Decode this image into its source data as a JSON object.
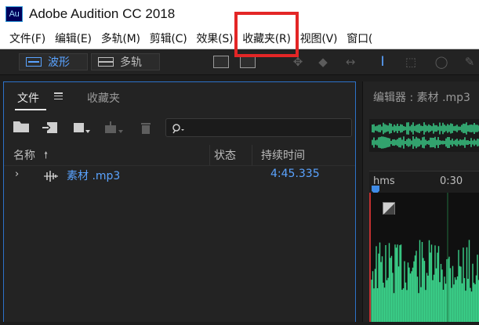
{
  "window": {
    "app_icon_text": "Au",
    "title": "Adobe Audition CC 2018"
  },
  "menu": [
    {
      "label": "文件(F)"
    },
    {
      "label": "编辑(E)"
    },
    {
      "label": "多轨(M)"
    },
    {
      "label": "剪辑(C)"
    },
    {
      "label": "效果(S)",
      "highlighted": true
    },
    {
      "label": "收藏夹(R)"
    },
    {
      "label": "视图(V)"
    },
    {
      "label": "窗口("
    }
  ],
  "toolbar": {
    "waveform_label": "波形",
    "multitrack_label": "多轨",
    "active_mode": "waveform"
  },
  "files_panel": {
    "tab_files": "文件",
    "tab_favorites": "收藏夹",
    "columns": {
      "name": "名称",
      "status": "状态",
      "duration": "持续时间"
    },
    "files": [
      {
        "name": "素材 .mp3",
        "status": "",
        "duration": "4:45.335"
      }
    ]
  },
  "editor": {
    "tab_label": "编辑器 : 素材 .mp3",
    "ruler_unit": "hms",
    "ruler_mark": "0:30"
  },
  "colors": {
    "accent": "#5aa3ff",
    "waveform": "#3ad089",
    "highlight": "#e32626",
    "playhead": "#c23030"
  }
}
